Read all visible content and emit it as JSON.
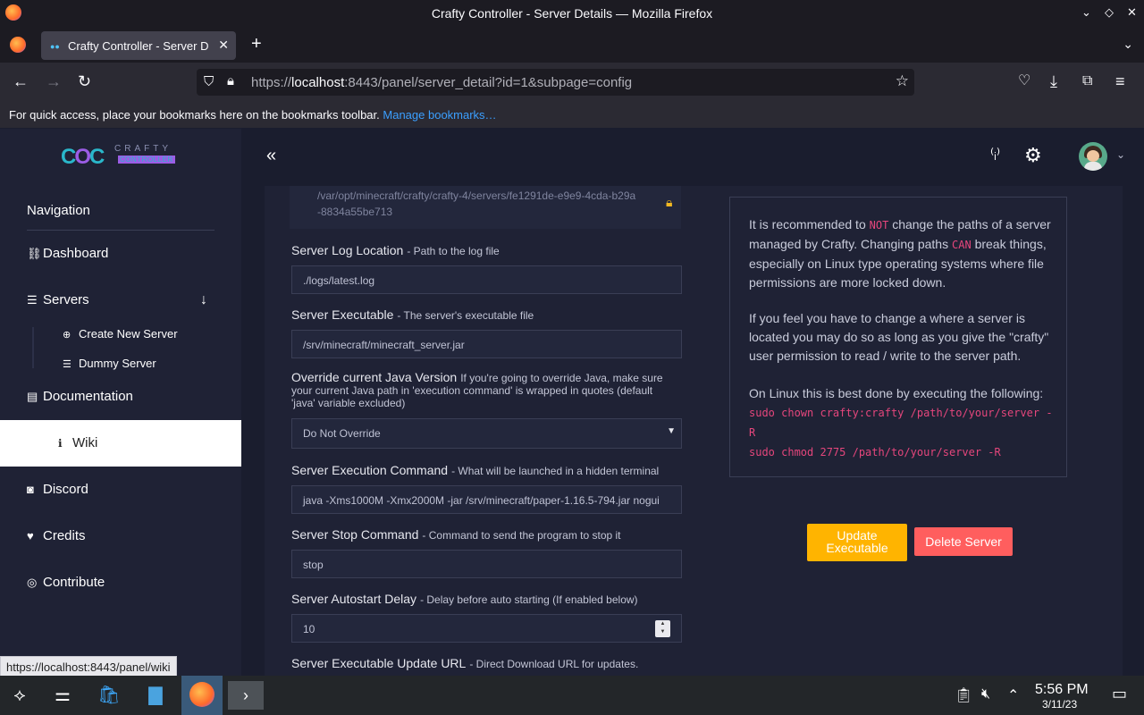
{
  "browser": {
    "window_title": "Crafty Controller - Server Details — Mozilla Firefox",
    "tab_label": "Crafty Controller - Server D",
    "url_prefix": "https://",
    "url_host": "localhost",
    "url_rest": ":8443/panel/server_detail?id=1&subpage=config",
    "bookmarks_text": "For quick access, place your bookmarks here on the bookmarks toolbar.",
    "bookmarks_link": "Manage bookmarks…",
    "status_url": "https://localhost:8443/panel/wiki"
  },
  "logo": {
    "top": "CRAFTY",
    "bottom": "CONTROLLER"
  },
  "sidebar": {
    "heading": "Navigation",
    "dashboard": "Dashboard",
    "servers": "Servers",
    "create_server": "Create New Server",
    "dummy_server": "Dummy Server",
    "documentation": "Documentation",
    "wiki": "Wiki",
    "discord": "Discord",
    "credits": "Credits",
    "contribute": "Contribute"
  },
  "form": {
    "path_value": "/var/opt/minecraft/crafty/crafty-4/servers/fe1291de-e9e9-4cda-b29a-8834a55be713",
    "log_label": "Server Log Location",
    "log_hint": "- Path to the log file",
    "log_value": "./logs/latest.log",
    "exe_label": "Server Executable",
    "exe_hint": "- The server's executable file",
    "exe_value": "/srv/minecraft/minecraft_server.jar",
    "java_label": "Override current Java Version",
    "java_hint": "If you're going to override Java, make sure your current Java path in 'execution command' is wrapped in quotes (default 'java' variable excluded)",
    "java_value": "Do Not Override",
    "cmd_label": "Server Execution Command",
    "cmd_hint": "- What will be launched in a hidden terminal",
    "cmd_value": "java -Xms1000M -Xmx2000M -jar /srv/minecraft/paper-1.16.5-794.jar nogui",
    "stop_label": "Server Stop Command",
    "stop_hint": "- Command to send the program to stop it",
    "stop_value": "stop",
    "delay_label": "Server Autostart Delay",
    "delay_hint": "- Delay before auto starting (If enabled below)",
    "delay_value": "10",
    "update_label": "Server Executable Update URL",
    "update_hint": "- Direct Download URL for updates."
  },
  "info": {
    "p1_a": "It is recommended to ",
    "p1_not": "NOT",
    "p1_b": " change the paths of a server managed by Crafty. Changing paths ",
    "p1_can": "CAN",
    "p1_c": " break things, especially on Linux type operating systems where file permissions are more locked down.",
    "p2": "If you feel you have to change a where a server is located you may do so as long as you give the \"crafty\" user permission to read / write to the server path.",
    "p3": "On Linux this is best done by executing the following:",
    "cmd1": "sudo chown crafty:crafty /path/to/your/server -R",
    "cmd2": "sudo chmod 2775 /path/to/your/server -R"
  },
  "buttons": {
    "update": "Update Executable",
    "delete": "Delete Server"
  },
  "clock": {
    "time": "5:56 PM",
    "date": "3/11/23"
  },
  "colors": {
    "accent_warning": "#ffb400",
    "accent_danger": "#ff5e5e",
    "code_pink": "#e5467c"
  }
}
